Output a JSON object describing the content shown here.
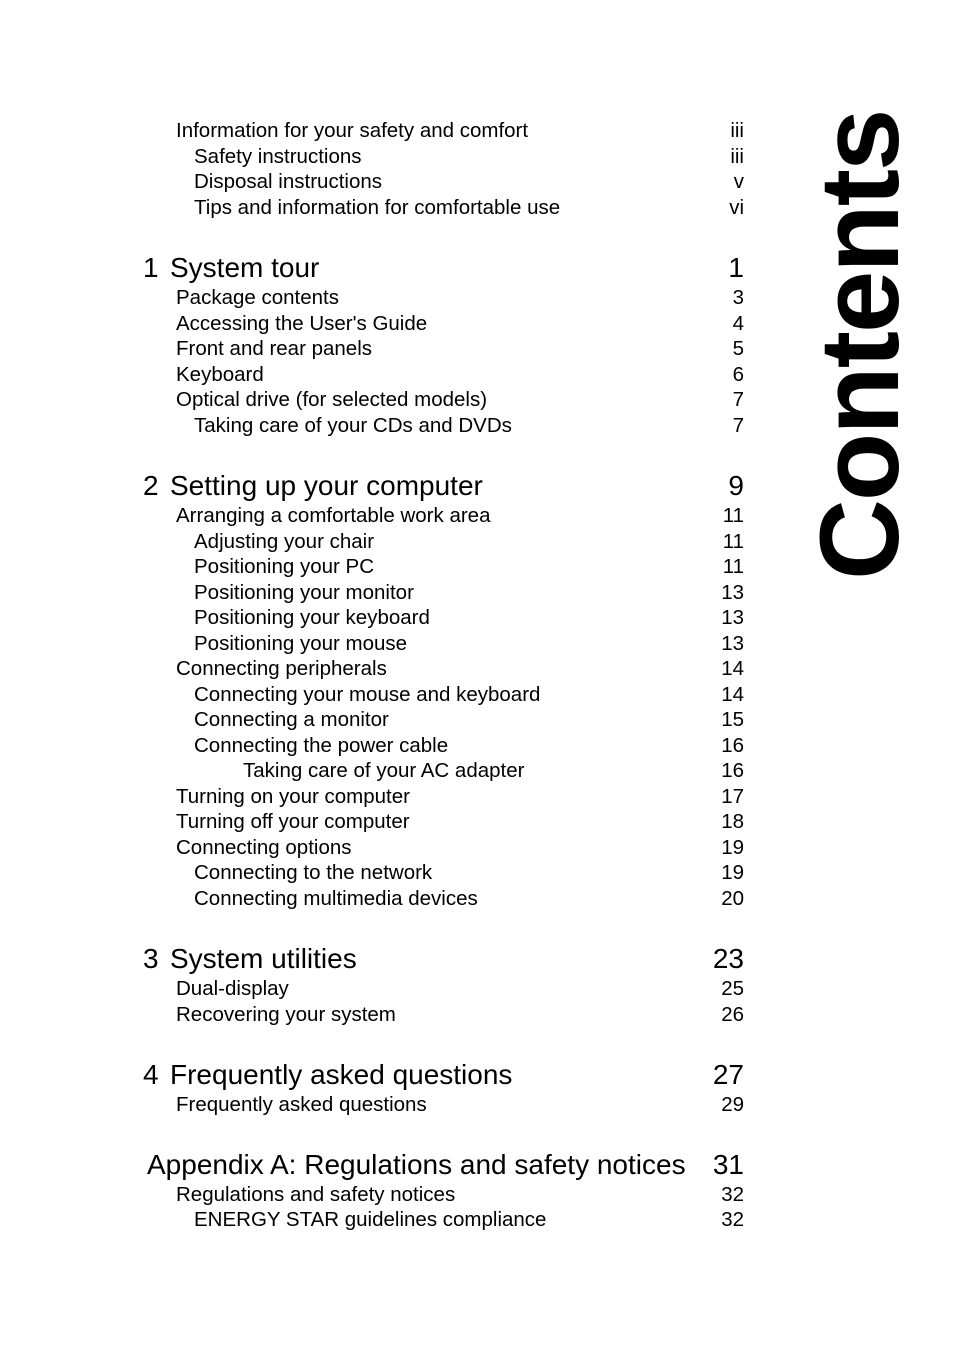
{
  "page": {
    "title": "Contents"
  },
  "toc": {
    "front_matter": [
      {
        "label": "Information for your safety and comfort",
        "page": "iii",
        "level": 0
      },
      {
        "label": "Safety instructions",
        "page": "iii",
        "level": 1
      },
      {
        "label": "Disposal instructions",
        "page": "v",
        "level": 1
      },
      {
        "label": "Tips and information for comfortable use",
        "page": "vi",
        "level": 1
      }
    ],
    "chapters": [
      {
        "number": "1",
        "title": "System tour",
        "page": "1",
        "entries": [
          {
            "label": "Package contents",
            "page": "3",
            "level": 0
          },
          {
            "label": "Accessing the User's Guide",
            "page": "4",
            "level": 0
          },
          {
            "label": "Front and rear panels",
            "page": "5",
            "level": 0
          },
          {
            "label": "Keyboard",
            "page": "6",
            "level": 0
          },
          {
            "label": "Optical drive (for selected models)",
            "page": "7",
            "level": 0
          },
          {
            "label": "Taking care of your CDs and DVDs",
            "page": "7",
            "level": 1
          }
        ]
      },
      {
        "number": "2",
        "title": "Setting up your computer",
        "page": "9",
        "entries": [
          {
            "label": "Arranging a comfortable work area",
            "page": "11",
            "level": 0
          },
          {
            "label": "Adjusting your chair",
            "page": "11",
            "level": 1
          },
          {
            "label": "Positioning your PC",
            "page": "11",
            "level": 1
          },
          {
            "label": "Positioning your monitor",
            "page": "13",
            "level": 1
          },
          {
            "label": "Positioning your keyboard",
            "page": "13",
            "level": 1
          },
          {
            "label": "Positioning your mouse",
            "page": "13",
            "level": 1
          },
          {
            "label": "Connecting peripherals",
            "page": "14",
            "level": 0
          },
          {
            "label": "Connecting your mouse and keyboard",
            "page": "14",
            "level": 1
          },
          {
            "label": "Connecting a monitor",
            "page": "15",
            "level": 1
          },
          {
            "label": "Connecting the power cable",
            "page": "16",
            "level": 1
          },
          {
            "label": "Taking care of your AC adapter",
            "page": "16",
            "level": 2
          },
          {
            "label": "Turning on your computer",
            "page": "17",
            "level": 0
          },
          {
            "label": "Turning off your computer",
            "page": "18",
            "level": 0
          },
          {
            "label": "Connecting options",
            "page": "19",
            "level": 0
          },
          {
            "label": "Connecting to the network",
            "page": "19",
            "level": 1
          },
          {
            "label": "Connecting multimedia devices",
            "page": "20",
            "level": 1
          }
        ]
      },
      {
        "number": "3",
        "title": "System utilities",
        "page": "23",
        "entries": [
          {
            "label": "Dual-display",
            "page": "25",
            "level": 0
          },
          {
            "label": "Recovering your system",
            "page": "26",
            "level": 0
          }
        ]
      },
      {
        "number": "4",
        "title": "Frequently asked questions",
        "page": "27",
        "entries": [
          {
            "label": "Frequently asked questions",
            "page": "29",
            "level": 0
          }
        ]
      }
    ],
    "appendix": {
      "title": "Appendix A: Regulations and safety notices",
      "page": "31",
      "entries": [
        {
          "label": "Regulations and safety notices",
          "page": "32",
          "level": 0
        },
        {
          "label": "ENERGY STAR guidelines compliance",
          "page": "32",
          "level": 1
        }
      ]
    }
  }
}
